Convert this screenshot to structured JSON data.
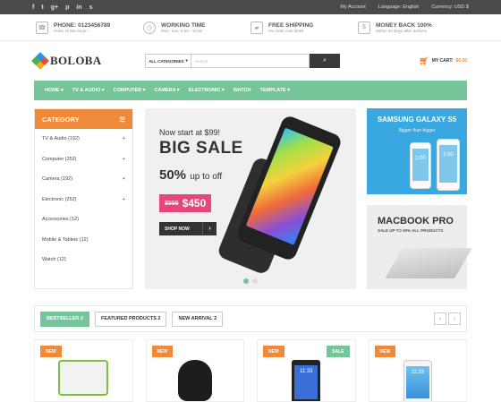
{
  "topbar": {
    "social": [
      "f",
      "t",
      "g+",
      "p",
      "in",
      "s"
    ],
    "account": "My Account",
    "language": "Language: English",
    "currency": "Currency: USD $"
  },
  "info": [
    {
      "icon": "phone-icon",
      "title": "PHONE: 0123456789",
      "sub": "Order Online Now !"
    },
    {
      "icon": "clock-icon",
      "title": "WORKING TIME",
      "sub": "Mon- Sun: 8.00 - 18.00"
    },
    {
      "icon": "truck-icon",
      "title": "FREE SHIPPING",
      "sub": "On order over $199"
    },
    {
      "icon": "money-icon",
      "title": "MONEY BACK 100%",
      "sub": "Within 30 Days after delivery"
    }
  ],
  "header": {
    "logo": "BOLOBA",
    "category_select": "ALL CATEGORIES",
    "search_placeholder": "Search",
    "cart_label": "MY CART:",
    "cart_amount": "$0.00"
  },
  "nav": [
    "HOME ▾",
    "TV & AUDIO ▾",
    "COMPUTER ▾",
    "CAMERA ▾",
    "ELECTRONIC ▾",
    "WATCH",
    "TEMPLATE ▾"
  ],
  "sidebar": {
    "title": "CATEGORY",
    "items": [
      {
        "label": "TV & Audio (192)",
        "expand": "+"
      },
      {
        "label": "Computer (252)",
        "expand": "+"
      },
      {
        "label": "Camera (192)",
        "expand": "+"
      },
      {
        "label": "Electronic (252)",
        "expand": "+"
      },
      {
        "label": "Accessories (12)",
        "expand": ""
      },
      {
        "label": "Mobile & Tablets (12)",
        "expand": ""
      },
      {
        "label": "Watch (12)",
        "expand": ""
      }
    ]
  },
  "banner": {
    "line1": "Now start at $99!",
    "line2": "BIG SALE",
    "percent": "50%",
    "percent_suffix": "up to off",
    "old_price": "$999",
    "new_price": "$450",
    "shop_button": "SHOP NOW",
    "slide_index": 1,
    "slide_count": 2
  },
  "ad1": {
    "title": "SAMSUNG GALAXY S5",
    "subtitle": "Bigger than bigger",
    "screen": "1:00"
  },
  "ad2": {
    "title": "MACBOOK PRO",
    "subtitle": "SALE UP TO 30% ALL PRODUCTS"
  },
  "tabs": [
    "BESTSELLER 2",
    "FEATURED PRODUCTS 2",
    "NEW ARRIVAL 2"
  ],
  "products": [
    {
      "badges": [
        "NEW"
      ],
      "screen": ""
    },
    {
      "badges": [
        "NEW"
      ],
      "screen": ""
    },
    {
      "badges": [
        "NEW",
        "SALE"
      ],
      "screen": "11:33"
    },
    {
      "badges": [
        "NEW"
      ],
      "screen": "11:33"
    }
  ],
  "colors": {
    "accent_green": "#76c49a",
    "accent_orange": "#ef8a3b",
    "sale_pink": "#e8457a",
    "ad_blue": "#3aa8e0"
  }
}
